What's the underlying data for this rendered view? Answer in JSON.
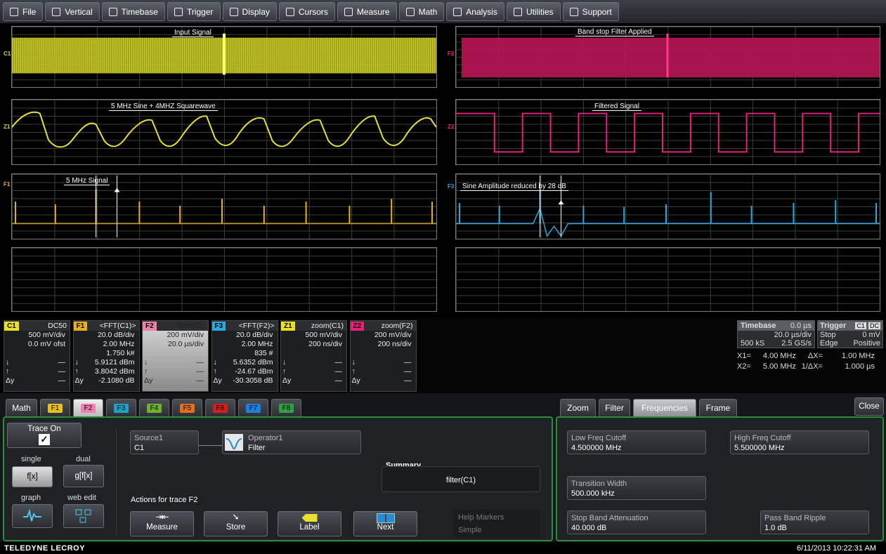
{
  "menu": {
    "items": [
      {
        "label": "File",
        "icon": "file-icon"
      },
      {
        "label": "Vertical",
        "icon": "vertical-icon"
      },
      {
        "label": "Timebase",
        "icon": "timebase-icon"
      },
      {
        "label": "Trigger",
        "icon": "trigger-icon"
      },
      {
        "label": "Display",
        "icon": "display-icon"
      },
      {
        "label": "Cursors",
        "icon": "cursors-icon"
      },
      {
        "label": "Measure",
        "icon": "measure-icon"
      },
      {
        "label": "Math",
        "icon": "math-icon"
      },
      {
        "label": "Analysis",
        "icon": "analysis-icon"
      },
      {
        "label": "Utilities",
        "icon": "utilities-icon"
      },
      {
        "label": "Support",
        "icon": "support-icon"
      }
    ]
  },
  "grids": {
    "c1": {
      "tag": "C1",
      "annotation": "Input Signal",
      "color": "#d4d42a"
    },
    "f2": {
      "tag": "F2",
      "annotation": "Band stop Filter Applied",
      "color": "#c8185a"
    },
    "z1": {
      "tag": "Z1",
      "annotation": "5 MHz Sine + 4MHZ Squarewave",
      "color": "#d4d42a"
    },
    "z2": {
      "tag": "Z2",
      "annotation": "Filtered Signal",
      "color": "#e8207a"
    },
    "f1": {
      "tag": "F1",
      "annotation": "5 MHz Signal",
      "color": "#e8b020"
    },
    "f3": {
      "tag": "F3",
      "annotation": "Sine Amplitude reduced by 28 dB",
      "color": "#2aa8e0"
    }
  },
  "descriptors": [
    {
      "tag": "C1",
      "title": "DC50",
      "tagColor": "#e8e020",
      "rows": [
        "500 mV/div",
        "0.0 mV ofst",
        ""
      ],
      "v1": "",
      "v2": "",
      "dy": ""
    },
    {
      "tag": "F1",
      "title": "<FFT(C1)>",
      "tagColor": "#e8b020",
      "rows": [
        "20.0 dB/div",
        "2.00 MHz",
        "1.750 k#"
      ],
      "v1": "5.9121 dBm",
      "v2": "3.8042 dBm",
      "dy": "-2.1080 dB"
    },
    {
      "tag": "F2",
      "title": "filter(C1)",
      "tagColor": "#f080b0",
      "rows": [
        "200 mV/div",
        "20.0 µs/div",
        ""
      ],
      "v1": "",
      "v2": "",
      "dy": ""
    },
    {
      "tag": "F3",
      "title": "<FFT(F2)>",
      "tagColor": "#2aa8e0",
      "rows": [
        "20.0 dB/div",
        "2.00 MHz",
        "835 #"
      ],
      "v1": "5.6352 dBm",
      "v2": "-24.67 dBm",
      "dy": "-30.3058 dB"
    },
    {
      "tag": "Z1",
      "title": "zoom(C1)",
      "tagColor": "#e8e020",
      "rows": [
        "500 mV/div",
        "200 ns/div",
        ""
      ],
      "v1": "",
      "v2": "",
      "dy": ""
    },
    {
      "tag": "Z2",
      "title": "zoom(F2)",
      "tagColor": "#e8207a",
      "rows": [
        "200 mV/div",
        "200 ns/div",
        ""
      ],
      "v1": "",
      "v2": "",
      "dy": ""
    }
  ],
  "arrows": {
    "up": "↓",
    "down": "↑",
    "dy": "Δy",
    "dash": "—"
  },
  "timebase": {
    "label": "Timebase",
    "delay": "0.0 µs",
    "div": "20.0 µs/div",
    "samples": "500 kS",
    "rate": "2.5 GS/s",
    "trigger_label": "Trigger",
    "trigger_ch": "C1",
    "trigger_coupling": "DC",
    "trigger_mode": "Stop",
    "trigger_level": "0 mV",
    "trigger_type": "Edge",
    "trigger_slope": "Positive"
  },
  "cursors": {
    "x1_label": "X1=",
    "x1": "4.00 MHz",
    "dx_label": "ΔX=",
    "dx": "1.00 MHz",
    "x2_label": "X2=",
    "x2": "5.00 MHz",
    "idx_label": "1/ΔX=",
    "idx": "1.000 µs"
  },
  "left_tabs": [
    {
      "label": "Math",
      "color": ""
    },
    {
      "label": "F1",
      "color": "#e8c020"
    },
    {
      "label": "F2",
      "color": "#f080b0"
    },
    {
      "label": "F3",
      "color": "#20a0c8"
    },
    {
      "label": "F4",
      "color": "#70b030"
    },
    {
      "label": "F5",
      "color": "#e07020"
    },
    {
      "label": "F6",
      "color": "#d02020"
    },
    {
      "label": "F7",
      "color": "#2080e0"
    },
    {
      "label": "F8",
      "color": "#30a040"
    }
  ],
  "math_panel": {
    "trace_on": "Trace On",
    "single": "single",
    "dual": "dual",
    "single_btn": "f[x]",
    "dual_btn": "g[f[x]",
    "graph": "graph",
    "web_edit": "web edit",
    "source_label": "Source1",
    "source_value": "C1",
    "operator_label": "Operator1",
    "operator_value": "Filter",
    "summary_label": "Summary",
    "summary_value": "filter(C1)",
    "actions_label": "Actions for trace F2",
    "measure": "Measure",
    "store": "Store",
    "label": "Label",
    "next": "Next",
    "help_markers": "Help Markers",
    "help_value": "Simple"
  },
  "right_tabs": [
    "Zoom",
    "Filter",
    "Frequencies",
    "Frame"
  ],
  "close": "Close",
  "filter_panel": {
    "low_label": "Low Freq Cutoff",
    "low_value": "4.500000 MHz",
    "high_label": "High Freq Cutoff",
    "high_value": "5.500000 MHz",
    "tw_label": "Transition Width",
    "tw_value": "500.000 kHz",
    "sba_label": "Stop Band Attenuation",
    "sba_value": "40.000 dB",
    "pbr_label": "Pass Band Ripple",
    "pbr_value": "1.0 dB"
  },
  "footer": {
    "logo": "TELEDYNE LECROY",
    "datetime": "6/11/2013 10:22:31 AM"
  }
}
